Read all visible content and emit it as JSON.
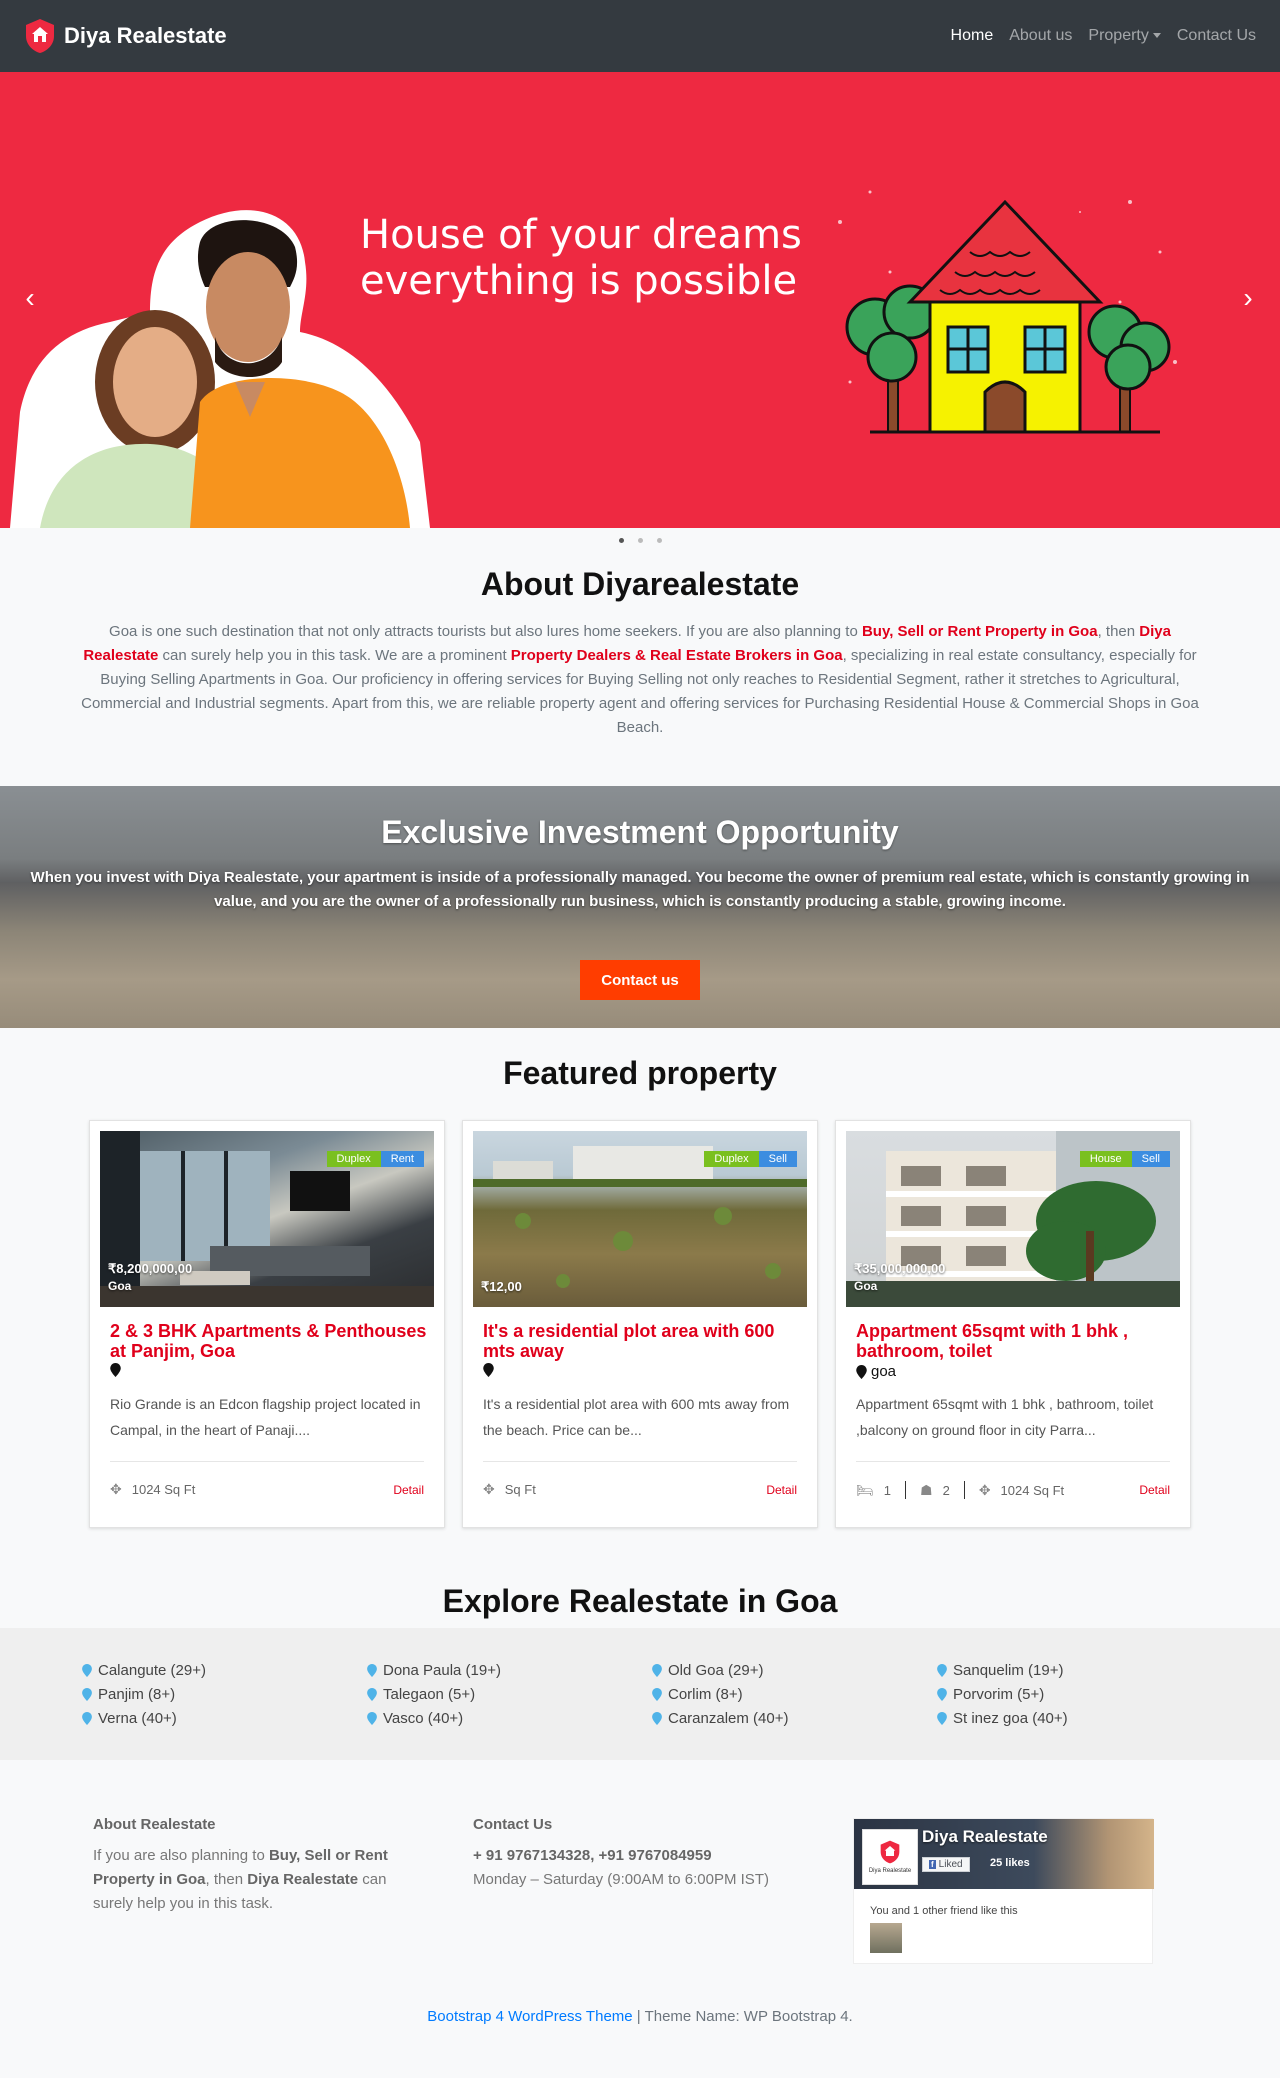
{
  "nav": {
    "brand": "Diya Realestate",
    "links": [
      "Home",
      "About us",
      "Property",
      "Contact Us"
    ]
  },
  "hero": {
    "line1": "House of your dreams",
    "line2": "everything is possible",
    "prev_icon": "chevron-left-icon",
    "next_icon": "chevron-right-icon",
    "slides": 3,
    "active_slide": 1
  },
  "about": {
    "title": "About Diyarealestate",
    "p1": "Goa is one such destination that not only attracts tourists but also lures home seekers. If you are also planning to ",
    "hl1": "Buy, Sell or Rent Property in Goa",
    "p2": ", then ",
    "hl2": "Diya Realestate",
    "p3": " can surely help you in this task. We are a prominent ",
    "hl3": "Property Dealers & Real Estate Brokers in Goa",
    "p4": ", specializing in real estate consultancy, especially for Buying Selling Apartments in Goa. Our proficiency in offering services for Buying Selling not only reaches to Residential Segment, rather it stretches to Agricultural, Commercial and Industrial segments. Apart from this, we are reliable property agent and offering services for Purchasing Residential House & Commercial Shops in Goa Beach."
  },
  "invest": {
    "title": "Exclusive Investment Opportunity",
    "text": "When you invest with Diya Realestate, your apartment is inside of a professionally managed. You become the owner of premium real estate, which is constantly growing in value, and you are the owner of a professionally run business, which is constantly producing a stable, growing income.",
    "button": "Contact us"
  },
  "featured": {
    "title": "Featured property",
    "cards": [
      {
        "tag1": "Duplex",
        "tag2": "Rent",
        "price": "₹8,200,000,00",
        "img_location": "Goa",
        "title": "2 & 3 BHK Apartments & Penthouses at Panjim, Goa",
        "location": "",
        "desc": "Rio Grande is an Edcon flagship project located in Campal, in the heart of Panaji....",
        "area": "1024 Sq Ft",
        "detail": "Detail"
      },
      {
        "tag1": "Duplex",
        "tag2": "Sell",
        "price": "₹12,00",
        "img_location": "",
        "title": "It's a residential plot area with 600 mts away",
        "location": "",
        "desc": "It's a residential plot area with 600 mts away from the beach. Price can be...",
        "area": "Sq Ft",
        "detail": "Detail"
      },
      {
        "tag1": "House",
        "tag2": "Sell",
        "price": "₹35,000,000,00",
        "img_location": "Goa",
        "title": "Appartment 65sqmt with 1 bhk , bathroom, toilet",
        "location": "goa",
        "desc": "Appartment 65sqmt with 1 bhk , bathroom, toilet ,balcony on ground floor in city Parra...",
        "beds": "1",
        "baths": "2",
        "area": "1024 Sq Ft",
        "detail": "Detail"
      }
    ]
  },
  "explore": {
    "title": "Explore Realestate in Goa",
    "columns": [
      [
        "Calangute (29+)",
        "Panjim (8+)",
        "Verna (40+)"
      ],
      [
        "Dona Paula (19+)",
        "Talegaon (5+)",
        "Vasco (40+)"
      ],
      [
        "Old Goa (29+)",
        "Corlim (8+)",
        "Caranzalem (40+)"
      ],
      [
        "Sanquelim (19+)",
        "Porvorim (5+)",
        "St inez goa (40+)"
      ]
    ],
    "pin_color": "#4fb3e8"
  },
  "footer": {
    "about_head": "About Realestate",
    "about_p1": "If you are also planning to ",
    "about_b1": "Buy, Sell or Rent Property in Goa",
    "about_p2": ", then ",
    "about_b2": "Diya Realestate",
    "about_p3": " can surely help you in this task.",
    "contact_head": "Contact Us",
    "phones": "+ 91 9767134328, +91 9767084959",
    "hours": "Monday – Saturday (9:00AM to 6:00PM IST)",
    "fb_name": "Diya Realestate",
    "fb_avatar_label": "Diya Realestate",
    "fb_liked": "Liked",
    "fb_likes": "25 likes",
    "fb_friends": "You and 1 other friend like this",
    "bottom_link": "Bootstrap 4 WordPress Theme",
    "bottom_text": " | Theme Name: WP Bootstrap 4."
  },
  "colors": {
    "hero_bg": "#ee2941",
    "accent_red": "#e0001b",
    "button_orange": "#ff3d00",
    "navbar": "#343a40",
    "tag_green": "#7ac01f",
    "tag_blue": "#3c8de0"
  }
}
